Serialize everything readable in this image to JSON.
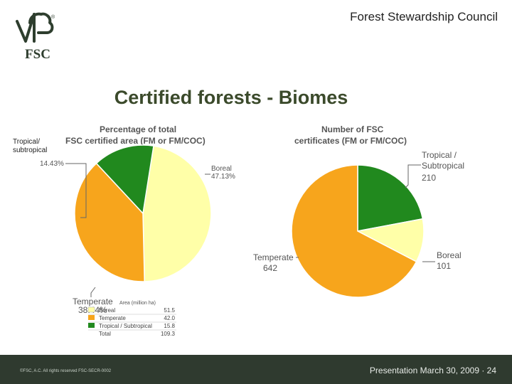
{
  "header": {
    "org": "Forest Stewardship Council"
  },
  "logo": {
    "mark": "FSC",
    "reg": "®"
  },
  "slide": {
    "title": "Certified forests - Biomes"
  },
  "colors": {
    "boreal": "#FFFFA8",
    "temperate": "#F7A51C",
    "tropical": "#21891E",
    "stroke": "#ffffff",
    "label": "#555555"
  },
  "chart_data": [
    {
      "type": "pie",
      "title": "Percentage of total FSC certified area (FM or FM/COC)",
      "slices": [
        {
          "name": "Boreal",
          "value": 47.13,
          "label": "Boreal",
          "value_label": "47.13%"
        },
        {
          "name": "Temperate",
          "value": 38.44,
          "label": "Temperate",
          "value_label": "38.44%"
        },
        {
          "name": "Tropical/ subtropical",
          "value": 14.43,
          "label": "Tropical/ subtropical",
          "value_label": "14.43%"
        }
      ],
      "table": {
        "header": "Area (million ha)",
        "rows": [
          {
            "name": "Boreal",
            "value": "51.5"
          },
          {
            "name": "Temperate",
            "value": "42.0"
          },
          {
            "name": "Tropical / Subtropical",
            "value": "15.8"
          },
          {
            "name": "Total",
            "value": "109.3"
          }
        ]
      }
    },
    {
      "type": "pie",
      "title": "Number of FSC certificates (FM or FM/COC)",
      "slices": [
        {
          "name": "Tropical / Subtropical",
          "value": 210,
          "label": "Tropical / Subtropical",
          "value_label": "210"
        },
        {
          "name": "Boreal",
          "value": 101,
          "label": "Boreal",
          "value_label": "101"
        },
        {
          "name": "Temperate",
          "value": 642,
          "label": "Temperate",
          "value_label": "642"
        }
      ]
    }
  ],
  "footer": {
    "left": "©FSC, A.C. All rights reserved FSC-SECR-0002",
    "right": "Presentation March 30, 2009 · 24"
  }
}
